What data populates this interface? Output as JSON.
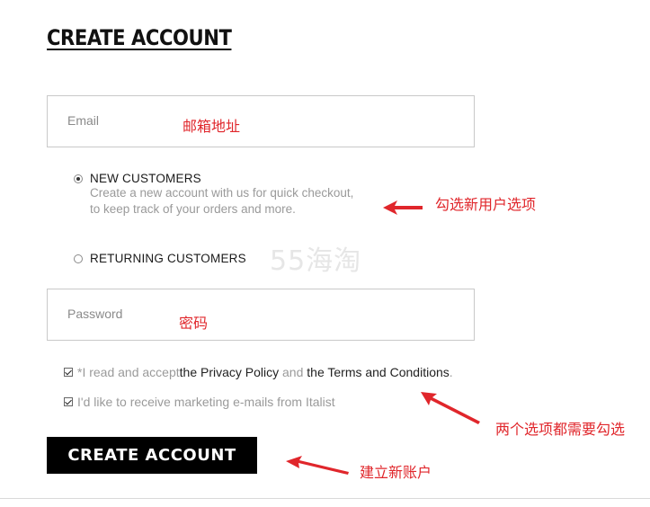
{
  "page": {
    "title": "CREATE ACCOUNT"
  },
  "email": {
    "placeholder": "Email",
    "annotation": "邮箱地址"
  },
  "customer_type": {
    "new": {
      "label": "NEW CUSTOMERS",
      "desc_line1": "Create a new account with us for quick checkout,",
      "desc_line2": "to keep track of your orders and more.",
      "selected": true
    },
    "returning": {
      "label": "RETURNING CUSTOMERS",
      "selected": false
    },
    "annotation": "勾选新用户选项"
  },
  "password": {
    "placeholder": "Password",
    "annotation": "密码"
  },
  "consents": {
    "privacy": {
      "prefix": "*I read and accept ",
      "link1": "the Privacy Policy",
      "mid": " and ",
      "link2": "the Terms and Conditions",
      "suffix": ".",
      "checked": true
    },
    "marketing": {
      "label": "I'd like to receive marketing e-mails from Italist",
      "checked": true
    },
    "annotation": "两个选项都需要勾选"
  },
  "submit": {
    "label": "CREATE ACCOUNT",
    "annotation": "建立新账户"
  },
  "watermark": "55海淘",
  "colors": {
    "annotation": "#e0262b",
    "button": "#000000"
  }
}
